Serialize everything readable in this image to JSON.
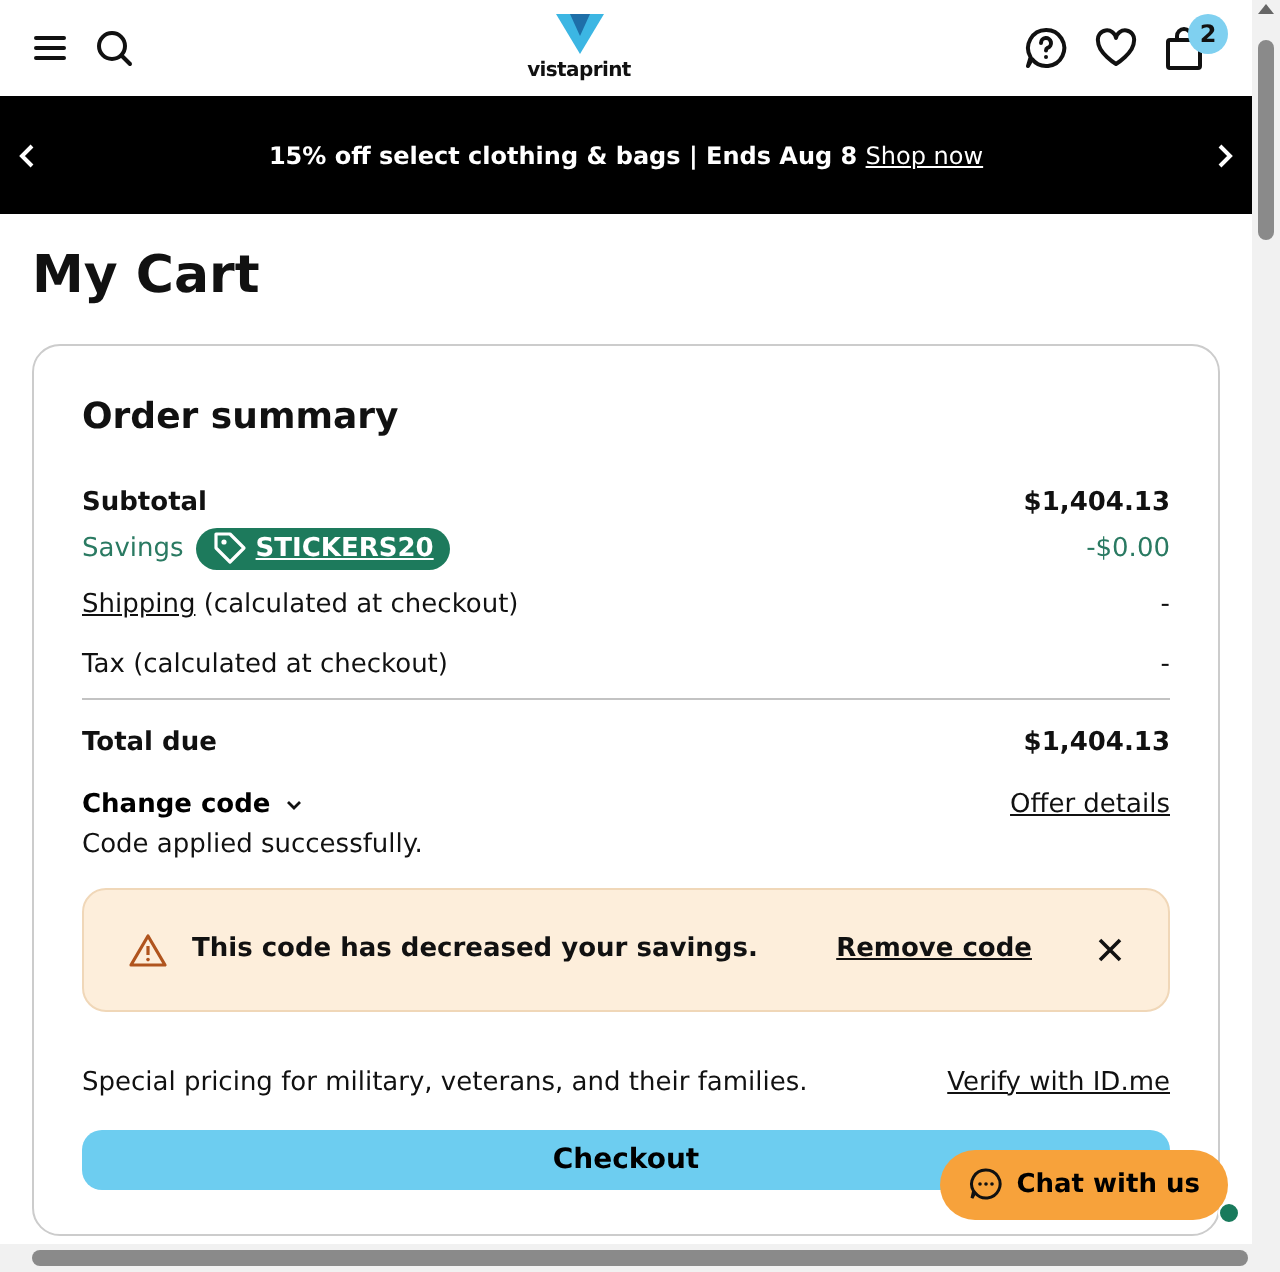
{
  "header": {
    "logo_text": "vistaprint",
    "cart_count": "2"
  },
  "promo_banner": {
    "text": "15% off select clothing & bags | Ends Aug 8",
    "link": "Shop now"
  },
  "page_title": "My Cart",
  "order_summary": {
    "title": "Order summary",
    "lines": [
      {
        "kind": "plain",
        "label": "Subtotal",
        "value": "$1,404.13"
      },
      {
        "kind": "savings",
        "label": "Savings",
        "code": "STICKERS20",
        "value": "-$0.00"
      },
      {
        "kind": "link",
        "label_link": "Shipping",
        "label": "(calculated at checkout)",
        "value": "-"
      },
      {
        "kind": "muted",
        "label": "Tax (calculated at checkout)",
        "value": "-"
      }
    ],
    "total": {
      "label": "Total due",
      "value": "$1,404.13"
    },
    "change_code": {
      "label": "Change code",
      "expanded": false
    },
    "offer_details": "Offer details",
    "code_status": "Code applied successfully.",
    "alert": {
      "text": "This code has decreased your savings.",
      "action": "Remove code"
    },
    "military": {
      "text": "Special pricing for military, veterans, and their families.",
      "link": "Verify with ID.me"
    },
    "checkout_button": "Checkout"
  },
  "chat": {
    "label": "Chat with us",
    "online": true
  }
}
